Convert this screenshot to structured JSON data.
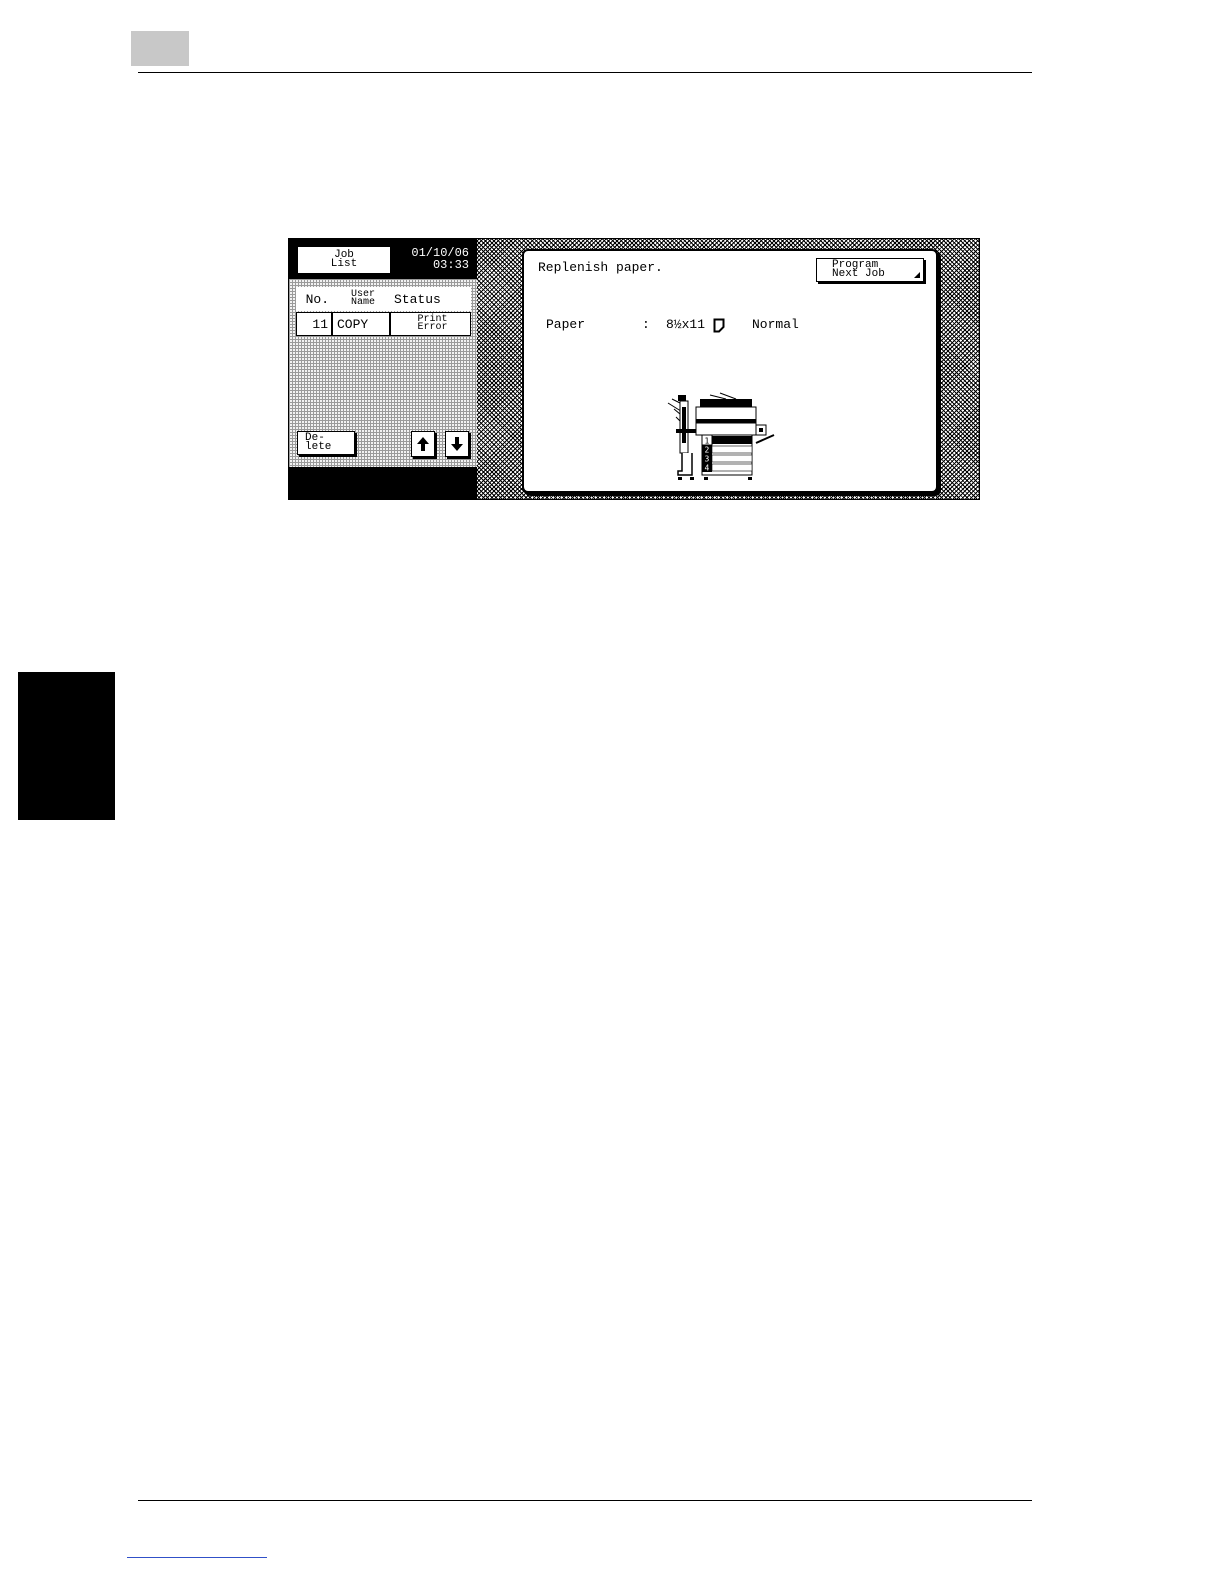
{
  "screen": {
    "job_list_button": [
      "Job",
      "List"
    ],
    "date": "01/10/06",
    "time": "03:33",
    "table": {
      "headers": {
        "no": "No.",
        "user": [
          "User",
          "Name"
        ],
        "status": "Status"
      },
      "rows": [
        {
          "no": "11",
          "user": "COPY",
          "status": [
            "Print",
            "Error"
          ]
        }
      ]
    },
    "delete_button": [
      "De-",
      "lete"
    ],
    "message": "Replenish paper.",
    "program_next_job": [
      "Program",
      "Next Job"
    ],
    "paper": {
      "label": "Paper",
      "separator": ":",
      "size": "8½x11",
      "type": "Normal"
    },
    "trays": [
      "1",
      "2",
      "3",
      "4"
    ]
  }
}
